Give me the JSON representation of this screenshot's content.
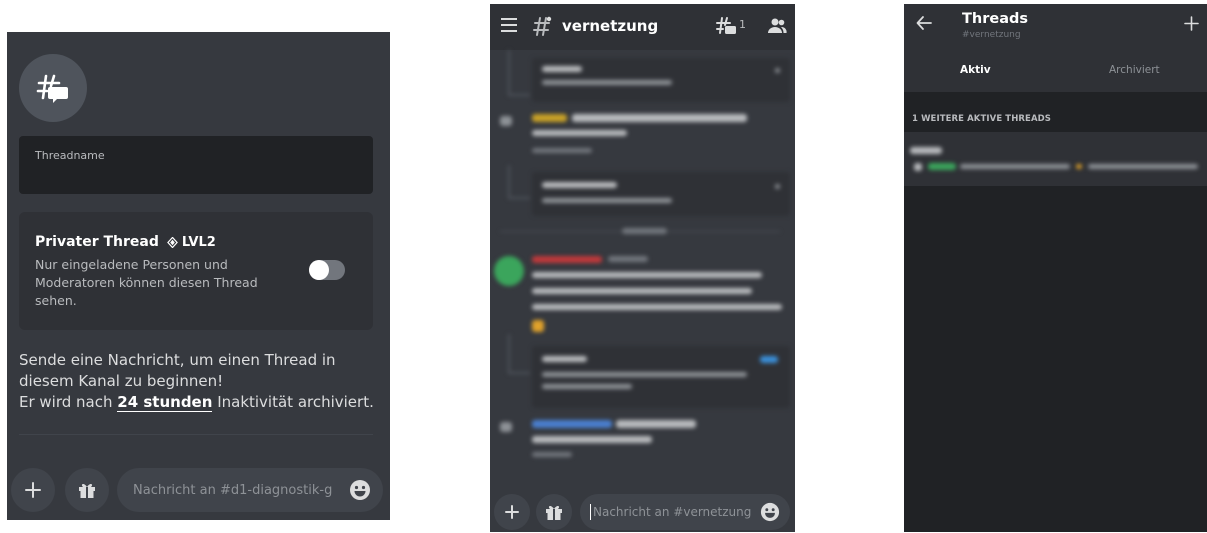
{
  "panel_create": {
    "name_placeholder": "Threadname",
    "private_title": "Privater Thread",
    "private_badge": "LVL2",
    "private_desc": "Nur eingeladene Personen und Moderatoren können diesen Thread sehen.",
    "private_toggle_on": false,
    "info_line1": "Sende eine Nachricht, um einen Thread in diesem Kanal zu beginnen!",
    "info_prefix": "Er wird nach ",
    "info_duration": "24 stunden",
    "info_suffix": " Inaktivität archiviert.",
    "message_placeholder": "Nachricht an #d1-diagnostik-g..."
  },
  "panel_channel": {
    "channel_name": "vernetzung",
    "threads_count": "1",
    "message_placeholder": "Nachricht an #vernetzung"
  },
  "panel_threads": {
    "title": "Threads",
    "subtitle": "#vernetzung",
    "tab_active": "Aktiv",
    "tab_archived": "Archiviert",
    "section_header": "1 WEITERE AKTIVE THREADS"
  },
  "icons": {
    "thread": "thread-icon",
    "add": "plus-icon",
    "gift": "gift-icon",
    "emoji": "emoji-icon",
    "menu": "hamburger-icon",
    "members": "members-icon",
    "back": "arrow-left-icon"
  },
  "colors": {
    "background": "#36393f",
    "secondary": "#2f3136",
    "tertiary": "#202225",
    "input": "#40444b",
    "text": "#dcddde",
    "muted": "#8e9297"
  }
}
